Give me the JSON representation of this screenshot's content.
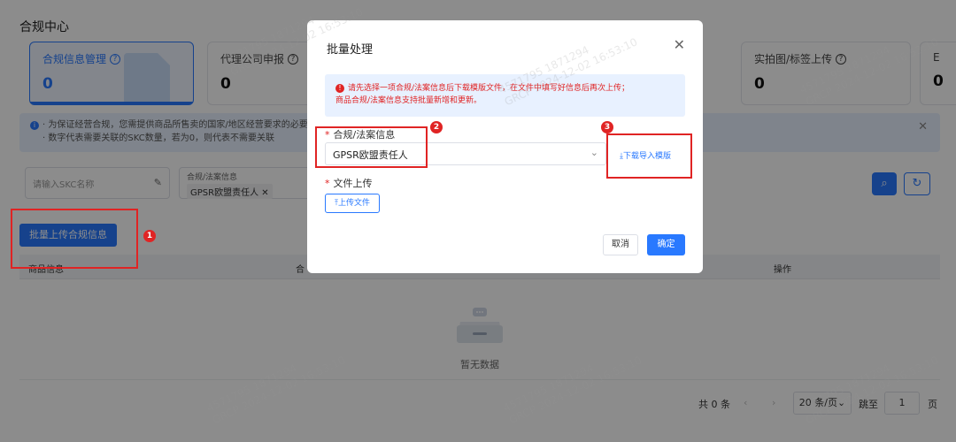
{
  "page": {
    "title": "合规中心"
  },
  "cards": [
    {
      "label": "合规信息管理",
      "value": "0",
      "active": true
    },
    {
      "label": "代理公司申报",
      "value": "0"
    },
    {
      "label": "实拍图/标签上传",
      "value": "0"
    },
    {
      "label": "E",
      "value": "0"
    }
  ],
  "notice": {
    "line1": "· 为保证经营合规，您需提供商品所售卖的国家/地区经营要求的必要文",
    "line2": "· 数字代表需要关联的SKC数量，若为0，则代表不需要关联"
  },
  "filters": {
    "skc_placeholder": "请输入SKC名称",
    "category_label": "合规/法案信息",
    "category_chip": "GPSR欧盟责任人"
  },
  "batch_button": "批量上传合规信息",
  "table": {
    "columns": [
      "商品信息",
      "合",
      "操作"
    ],
    "empty_text": "暂无数据"
  },
  "pagination": {
    "total": "共 0 条",
    "page_size": "20 条/页",
    "jump_label": "跳至",
    "page_input": "1",
    "page_suffix": "页"
  },
  "modal": {
    "title": "批量处理",
    "warning_line1": "请先选择一项合规/法案信息后下载模版文件，在文件中填写好信息后再次上传；",
    "warning_line2": "商品合规/法案信息支持批量新增和更新。",
    "field1_label": "合规/法案信息",
    "field1_value": "GPSR欧盟责任人",
    "download_link": "下载导入模版",
    "field2_label": "文件上传",
    "upload_button": "上传文件",
    "cancel": "取消",
    "confirm": "确定"
  },
  "badges": [
    "1",
    "2",
    "3"
  ],
  "watermark": {
    "line1": "4571795 1871294",
    "line2": "GRCP 2024-12-02 16:53:10"
  },
  "colors": {
    "primary": "#2979ff",
    "annotation_red": "#e02424",
    "overlay": "rgba(0,0,0,0.45)"
  },
  "icons": [
    "help-circle-icon",
    "info-icon",
    "close-icon",
    "edit-icon",
    "search-icon",
    "refresh-icon",
    "chevron-down-icon",
    "download-icon",
    "upload-icon",
    "empty-box-icon",
    "chevron-left-icon",
    "chevron-right-icon"
  ]
}
